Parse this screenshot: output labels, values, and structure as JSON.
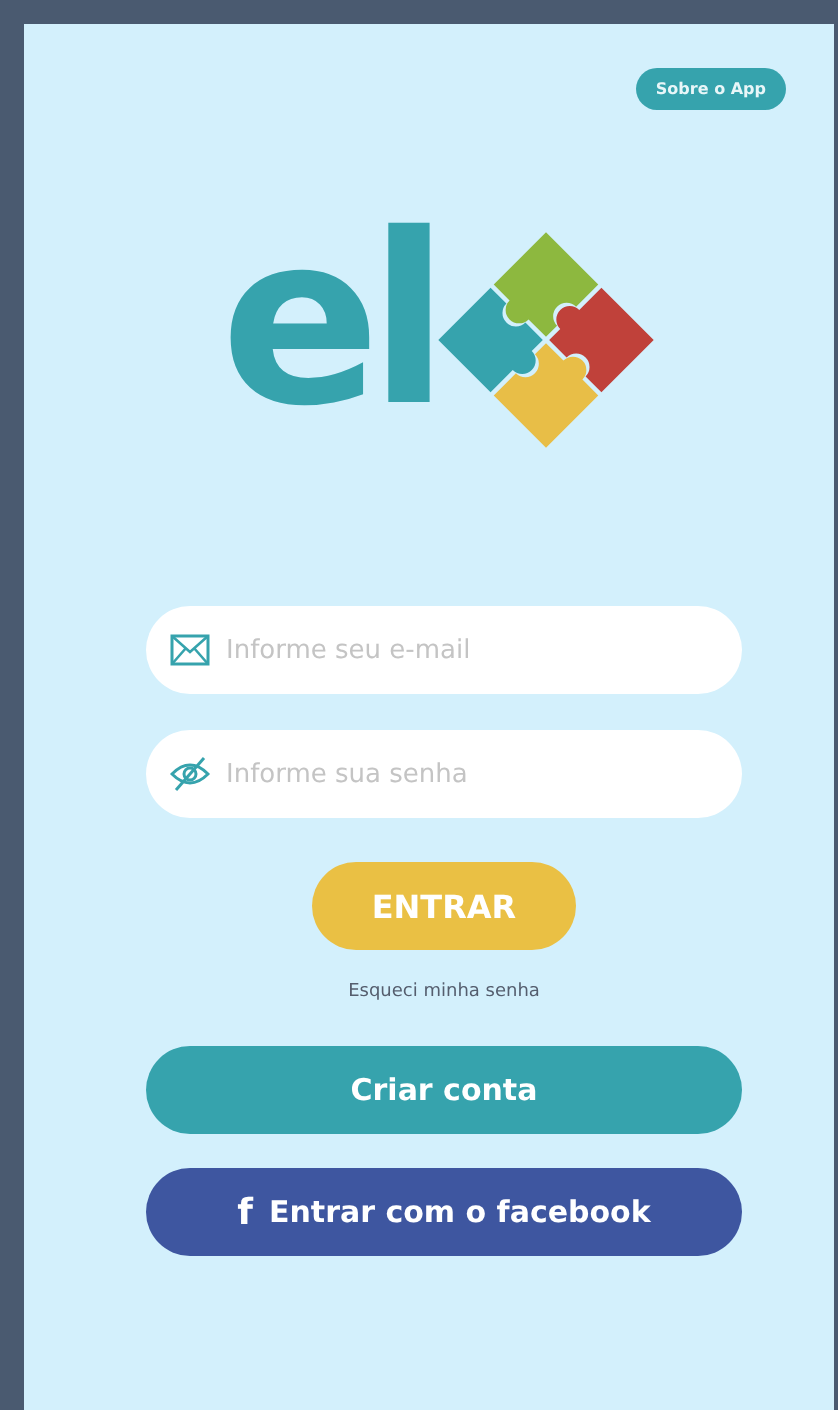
{
  "about_button": {
    "label": "Sobre o App"
  },
  "logo": {
    "text": "el"
  },
  "email_field": {
    "placeholder": "Informe seu e-mail"
  },
  "password_field": {
    "placeholder": "Informe sua senha"
  },
  "login_button": {
    "label": "ENTRAR"
  },
  "forgot_link": {
    "label": "Esqueci minha senha"
  },
  "create_account_button": {
    "label": "Criar conta"
  },
  "facebook_button": {
    "icon": "f",
    "label": "Entrar com o facebook"
  }
}
